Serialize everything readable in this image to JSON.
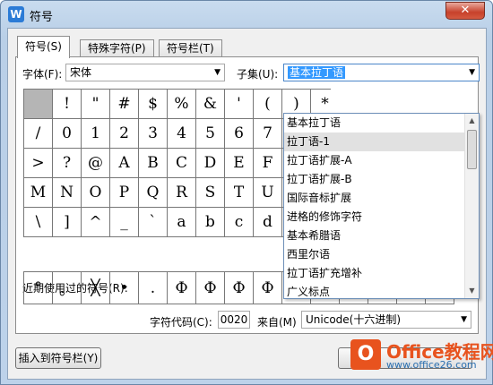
{
  "window": {
    "title": "符号",
    "close_glyph": "✕"
  },
  "tabs": [
    {
      "label": "符号(S)",
      "active": true
    },
    {
      "label": "特殊字符(P)",
      "active": false
    },
    {
      "label": "符号栏(T)",
      "active": false
    }
  ],
  "font": {
    "label": "字体(F):",
    "value": "宋体"
  },
  "subset": {
    "label": "子集(U):",
    "value": "基本拉丁语",
    "options": [
      "基本拉丁语",
      "拉丁语-1",
      "拉丁语扩展-A",
      "拉丁语扩展-B",
      "国际音标扩展",
      "进格的修饰字符",
      "基本希腊语",
      "西里尔语",
      "拉丁语扩充增补",
      "广义标点"
    ],
    "highlighted_index": 1
  },
  "symbols": [
    "",
    "!",
    "\"",
    "#",
    "$",
    "%",
    "&",
    "'",
    "(",
    ")",
    "*",
    "/",
    "0",
    "1",
    "2",
    "3",
    "4",
    "5",
    "6",
    "7",
    "8",
    "9",
    ">",
    "?",
    "@",
    "A",
    "B",
    "C",
    "D",
    "E",
    "F",
    "G",
    "H",
    "M",
    "N",
    "O",
    "P",
    "Q",
    "R",
    "S",
    "T",
    "U",
    "V",
    "W",
    "\\",
    "]",
    "^",
    "_",
    "`",
    "a",
    "b",
    "c",
    "d",
    "e",
    "f"
  ],
  "recent": {
    "label": "近期使用过的符号(R):",
    "items": [
      "°",
      "。",
      "╳",
      "•",
      ".",
      "Ф",
      "Ф",
      "Ф",
      "Ф",
      "Ф",
      "TEL",
      "Δ",
      "㎜",
      "≠",
      "¥"
    ]
  },
  "code": {
    "label": "字符代码(C):",
    "value": "0020",
    "from_label": "来自(M)",
    "from_value": "Unicode(十六进制)"
  },
  "buttons": {
    "insert_to_bar": "插入到符号栏(Y)"
  },
  "watermark": {
    "logo": "O",
    "line1": "Office教程网",
    "line2": "www.office26.com"
  },
  "colors": {
    "accent": "#3399ff",
    "watermark": "#e8531e"
  }
}
